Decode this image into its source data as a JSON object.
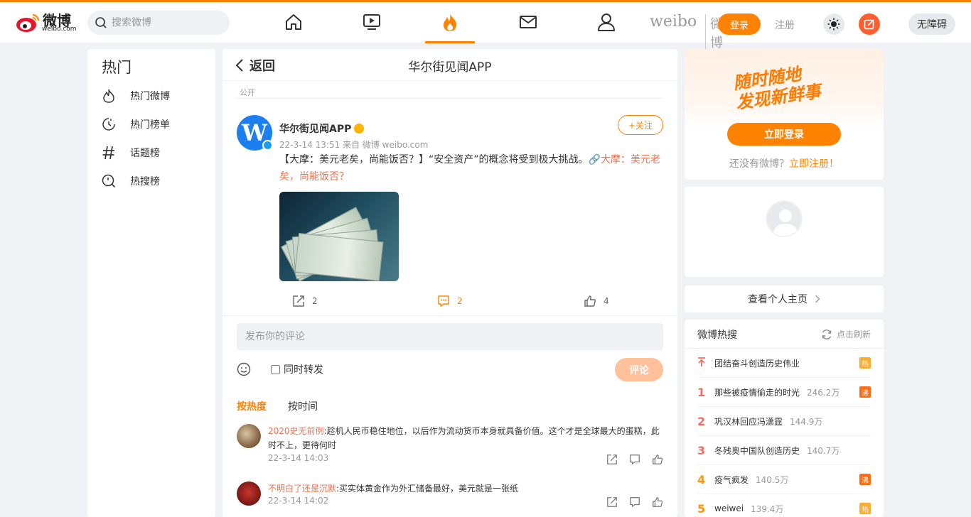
{
  "header": {
    "logo_text": "微博",
    "logo_sub": "weibo.com",
    "search_placeholder": "搜索微博",
    "brand_mark": "weibo",
    "brand_mark_cn": "微博",
    "login_label": "登录",
    "register_label": "注册",
    "accessibility_label": "无障碍",
    "accent_color": "#ff8200"
  },
  "sidebar": {
    "title": "热门",
    "items": [
      {
        "label": "热门微博",
        "icon": "flame-icon"
      },
      {
        "label": "热门榜单",
        "icon": "chart-clock-icon"
      },
      {
        "label": "话题榜",
        "icon": "hashtag-icon"
      },
      {
        "label": "热搜榜",
        "icon": "search-ranking-icon"
      }
    ]
  },
  "main": {
    "back_label": "返回",
    "title": "华尔街见闻APP",
    "visibility": "公开",
    "post": {
      "author": "华尔街见闻APP",
      "avatar_letter": "W",
      "meta": "22-3-14 13:51  来自 微博 weibo.com",
      "follow_label": "+关注",
      "text": "【大摩：美元老矣，尚能饭否？】“安全资产”的概念将受到极大挑战。",
      "link_text": "大摩：美元老矣，尚能饭否？",
      "reposts": "2",
      "comments": "2",
      "likes": "4"
    },
    "comment_placeholder": "发布你的评论",
    "repost_checkbox_label": "同时转发",
    "submit_label": "评论",
    "sort_hot": "按热度",
    "sort_time": "按时间",
    "comments": [
      {
        "user": "2020史无前例",
        "text": ":趁机人民币稳住地位，以后作为流动货币本身就具备价值。这个才是全球最大的蛋糕，此时不上，更待何时",
        "time": "22-3-14 14:03"
      },
      {
        "user": "不明白了还是沉默",
        "text": ":买实体黄金作为外汇储备最好，美元就是一张纸",
        "time": "22-3-14 14:02"
      }
    ]
  },
  "right": {
    "slogan_line1": "随时随地",
    "slogan_line2": "发现新鲜事",
    "login_button": "立即登录",
    "no_account_text": "还没有微博？",
    "register_link": "立即注册！",
    "view_home": "查看个人主页",
    "hot_title": "微博热搜",
    "refresh_label": "点击刷新",
    "hot_list": [
      {
        "rank": "",
        "title": "团结奋斗创造历史伟业",
        "count": "",
        "badge": "热",
        "badge_color": "#ffab2d"
      },
      {
        "rank": "1",
        "title": "那些被疫情偷走的时光",
        "count": "246.2万",
        "badge": "沸",
        "badge_color": "#ff6d13"
      },
      {
        "rank": "2",
        "title": "巩汉林回应冯潇霆",
        "count": "144.9万",
        "badge": "",
        "badge_color": ""
      },
      {
        "rank": "3",
        "title": "冬残奥中国队创造历史",
        "count": "140.7万",
        "badge": "",
        "badge_color": ""
      },
      {
        "rank": "4",
        "title": "疫气疯发",
        "count": "140.5万",
        "badge": "沸",
        "badge_color": "#ff6d13"
      },
      {
        "rank": "5",
        "title": "weiwei",
        "count": "139.4万",
        "badge": "热",
        "badge_color": "#ffab2d"
      }
    ]
  }
}
